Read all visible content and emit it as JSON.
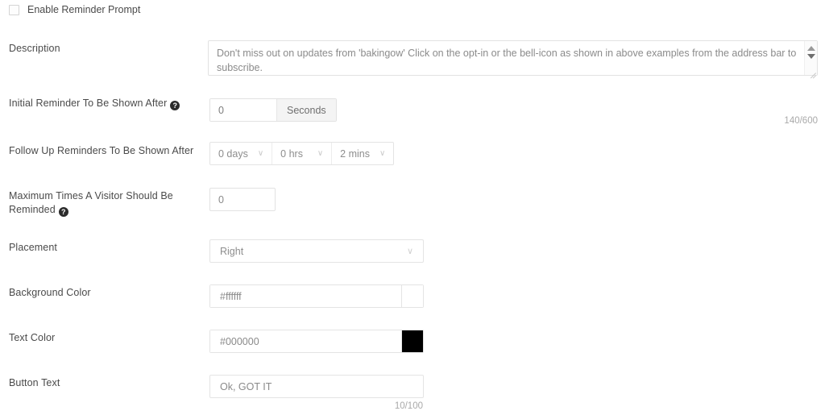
{
  "form": {
    "enable_reminder": {
      "label": "Enable Reminder Prompt",
      "checked": false
    },
    "description": {
      "label": "Description",
      "value": "Don't miss out on updates from 'bakingow' Click on the opt-in or the bell-icon as shown in above examples from the address bar to subscribe.",
      "counter": "140/600"
    },
    "initial_reminder": {
      "label": "Initial Reminder To Be Shown After",
      "help": "?",
      "value": "0",
      "unit": "Seconds"
    },
    "follow_up": {
      "label": "Follow Up Reminders To Be Shown After",
      "days": "0 days",
      "hours": "0 hrs",
      "minutes": "2 mins",
      "chevron": "∨"
    },
    "max_times": {
      "label_line1": "Maximum Times A Visitor Should Be",
      "label_line2": "Reminded",
      "help": "?",
      "value": "0"
    },
    "placement": {
      "label": "Placement",
      "value": "Right",
      "chevron": "∨"
    },
    "background_color": {
      "label": "Background Color",
      "value": "#ffffff",
      "swatch": "#ffffff"
    },
    "text_color": {
      "label": "Text Color",
      "value": "#000000",
      "swatch": "#000000"
    },
    "button_text": {
      "label": "Button Text",
      "value": "Ok, GOT IT",
      "counter": "10/100"
    }
  }
}
